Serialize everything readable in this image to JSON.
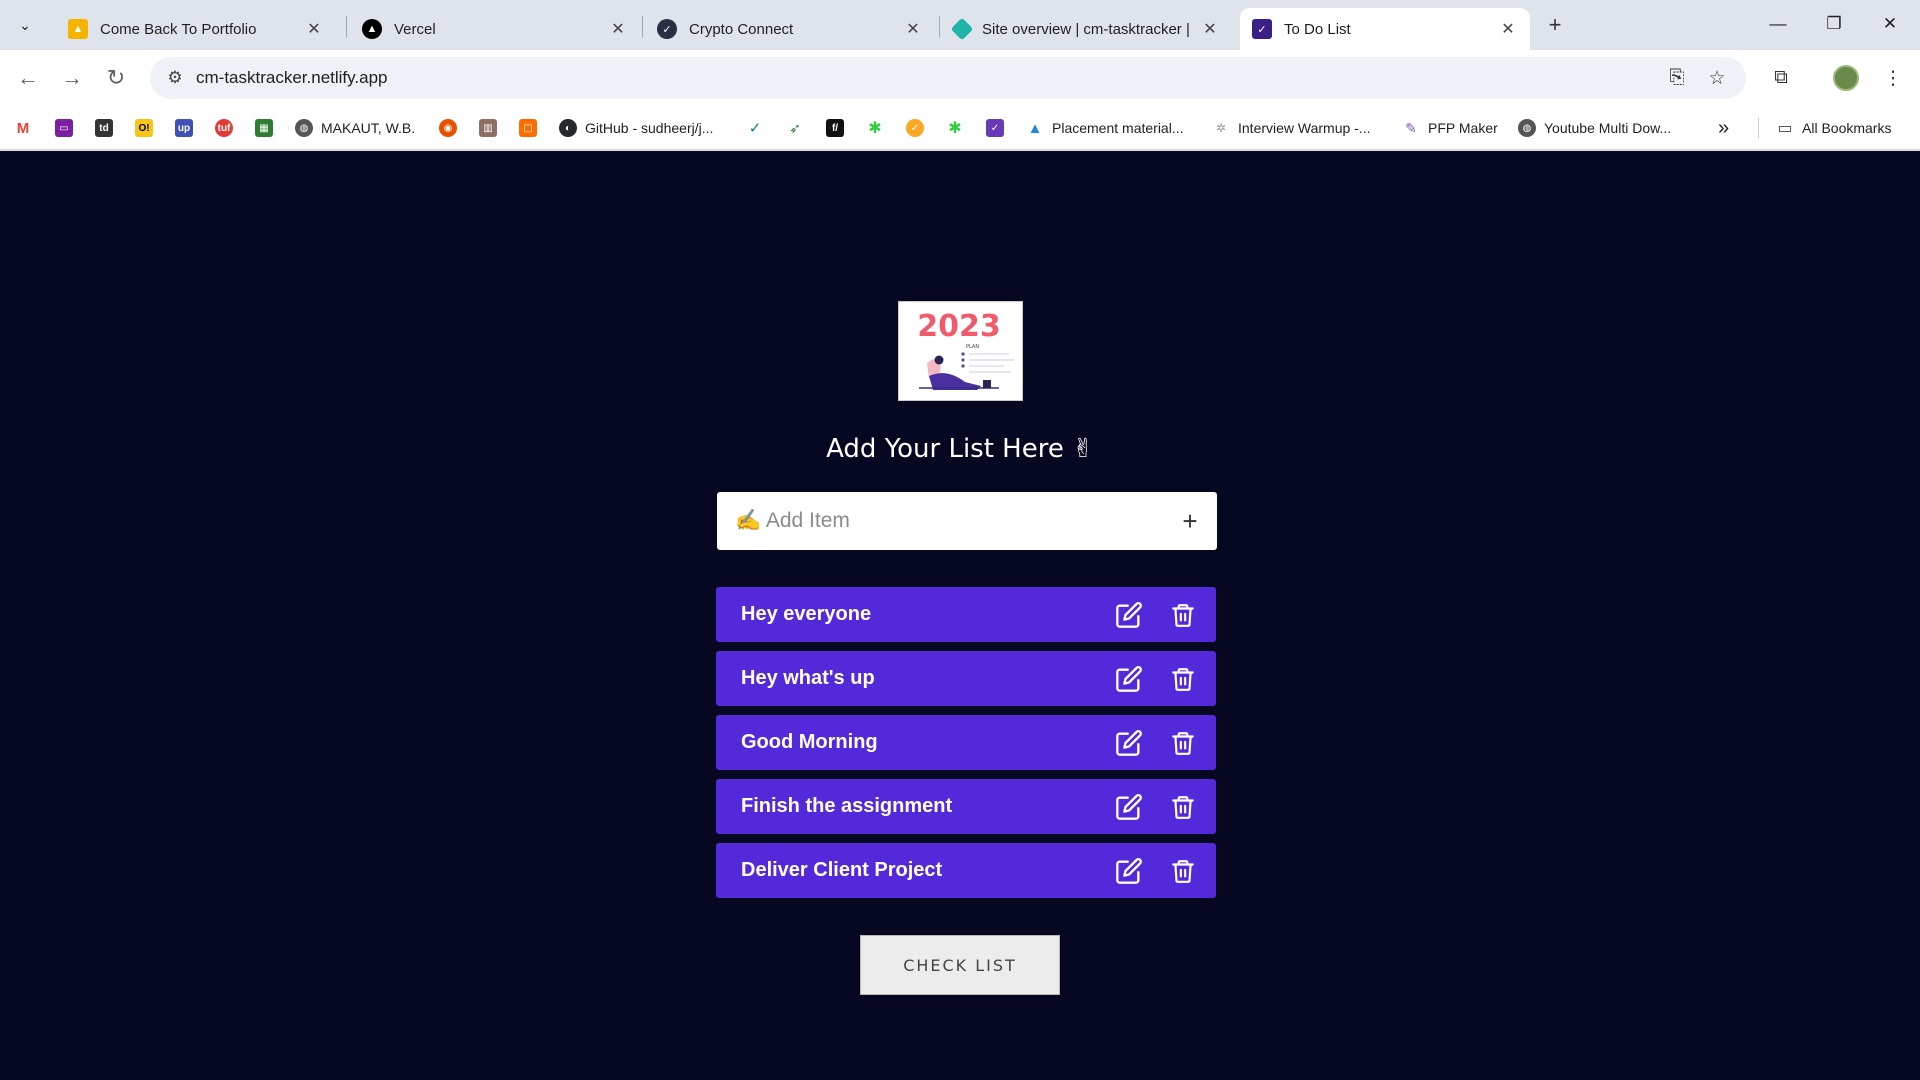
{
  "browser": {
    "tabs": [
      {
        "title": "Come Back To Portfolio",
        "icon": "portfolio-icon"
      },
      {
        "title": "Vercel",
        "icon": "vercel-icon"
      },
      {
        "title": "Crypto Connect",
        "icon": "crypto-icon"
      },
      {
        "title": "Site overview | cm-tasktracker |",
        "icon": "netlify-icon"
      },
      {
        "title": "To Do List",
        "icon": "todo-icon",
        "active": true
      }
    ],
    "url": "cm-tasktracker.netlify.app",
    "bookmarks": [
      {
        "label": "MAKAUT, W.B.",
        "icon": "globe-icon"
      },
      {
        "label": "GitHub - sudheerj/j...",
        "icon": "github-icon"
      },
      {
        "label": "Placement material...",
        "icon": "drive-icon"
      },
      {
        "label": "Interview Warmup -...",
        "icon": "google-icon"
      },
      {
        "label": "PFP Maker",
        "icon": "pfp-icon"
      },
      {
        "label": "Youtube Multi Dow...",
        "icon": "globe-icon"
      }
    ],
    "all_bookmarks": "All Bookmarks",
    "more_bookmarks": "»"
  },
  "app": {
    "hero_year": "2023",
    "hero_caption": "PLAN",
    "heading": "Add Your List Here ✌",
    "add_placeholder": "✍️ Add Item",
    "add_button": "+",
    "items": [
      "Hey everyone",
      "Hey what's up",
      "Good Morning",
      "Finish the assignment",
      "Deliver Client Project"
    ],
    "check_button": "CHECK LIST"
  },
  "colors": {
    "page_bg": "#060822",
    "item_bg": "#5329d9",
    "accent": "#5329d9"
  }
}
